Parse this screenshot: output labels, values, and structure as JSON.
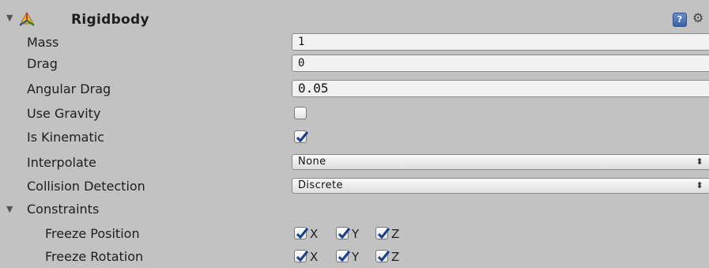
{
  "component": {
    "title": "Rigidbody",
    "fold_icon": "triangle-down",
    "component_icon": "rigidbody-icon",
    "help_icon": "help-icon",
    "help_glyph": "?",
    "settings_icon": "gear-icon"
  },
  "fields": {
    "mass": {
      "label": "Mass",
      "value": "1"
    },
    "drag": {
      "label": "Drag",
      "value": "0"
    },
    "angular_drag": {
      "label": "Angular Drag",
      "value": "0.05"
    },
    "use_gravity": {
      "label": "Use Gravity",
      "checked": false
    },
    "is_kinematic": {
      "label": "Is Kinematic",
      "checked": true
    },
    "interpolate": {
      "label": "Interpolate",
      "value": "None"
    },
    "collision_detection": {
      "label": "Collision Detection",
      "value": "Discrete"
    }
  },
  "constraints": {
    "label": "Constraints",
    "freeze_position": {
      "label": "Freeze Position",
      "x": "X",
      "y": "Y",
      "z": "Z"
    },
    "freeze_rotation": {
      "label": "Freeze Rotation",
      "x": "X",
      "y": "Y",
      "z": "Z"
    }
  },
  "colors": {
    "panel_bg": "#c2c2c2",
    "field_bg": "#f2f2f2",
    "checkmark": "#1a3f8a"
  }
}
